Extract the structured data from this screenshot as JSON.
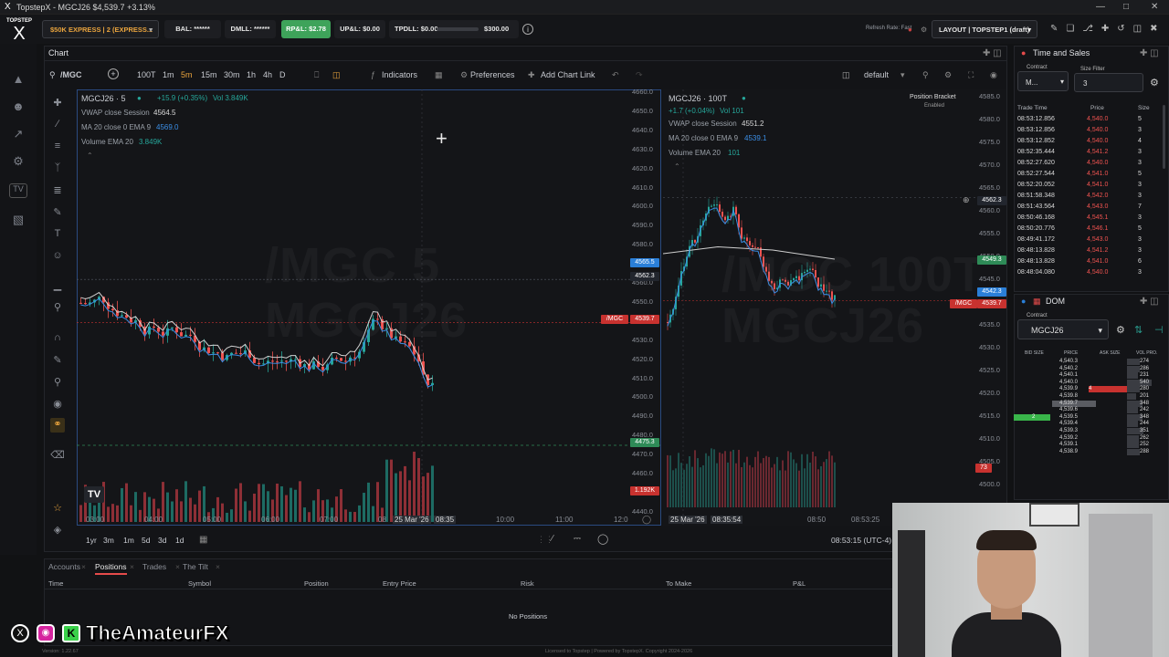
{
  "window": {
    "title": "TopstepX - MGCJ26 $4,539.7 +3.13%"
  },
  "topbar": {
    "account": "$50K EXPRESS | 2 (EXPRESS...",
    "bal": "BAL: ******",
    "dmll": "DMLL: ******",
    "rpl": "RP&L: $2.78",
    "upl": "UP&L: $0.00",
    "tpdll": "TPDLL: $0.00",
    "tpdll_limit": "$300.00",
    "refresh": "Refresh Rate: Fast",
    "layout": "LAYOUT | TOPSTEP1 (draft)"
  },
  "chart_panel": {
    "title": "Chart",
    "symbol": "/MGC",
    "timeframes": [
      "100T",
      "1m",
      "5m",
      "15m",
      "30m",
      "1h",
      "4h",
      "D"
    ],
    "active_timeframe": "5m",
    "indicators_label": "Indicators",
    "preferences_label": "Preferences",
    "add_chart_link_label": "Add Chart Link",
    "layout_name": "default",
    "ranges": [
      "1yr",
      "3m",
      "1m",
      "5d",
      "3d",
      "1d"
    ],
    "clock": "08:53:15 (UTC-4)"
  },
  "left_pane": {
    "title": "MGCJ26 · 5",
    "change": "+15.9 (+0.35%)",
    "vol": "Vol 3.849K",
    "vwap_label": "VWAP close Session",
    "vwap_val": "4564.5",
    "ma_label": "MA 20 close 0 EMA 9",
    "ma_val": "4569.0",
    "vol_label": "Volume EMA 20",
    "vol_val": "3.849K",
    "watermark1": "/MGC 5",
    "watermark2": "MGCJ26",
    "price_ticks": [
      "4660.0",
      "4650.0",
      "4640.0",
      "4630.0",
      "4620.0",
      "4610.0",
      "4600.0",
      "4590.0",
      "4580.0",
      "4570.0",
      "4560.0",
      "4550.0",
      "4540.0",
      "4530.0",
      "4520.0",
      "4510.0",
      "4500.0",
      "4490.0",
      "4480.0",
      "4470.0",
      "4460.0",
      "4450.0",
      "4440.0"
    ],
    "time_ticks": [
      "03:00",
      "04:00",
      "05:00",
      "06:00",
      "07:00",
      "08",
      "25 Mar '26",
      "08:35",
      "10:00",
      "11:00",
      "12:0"
    ],
    "label_vwap": "4565.5",
    "label_ma": "4562.3",
    "label_price": "4539.7",
    "label_symbol": "/MGC",
    "label_dash": "4475.3",
    "label_vol": "1.192K"
  },
  "right_pane": {
    "title": "MGCJ26 · 100T",
    "change": "+1.7 (+0.04%)",
    "vol": "Vol 101",
    "vwap_label": "VWAP close Session",
    "vwap_val": "4551.2",
    "ma_label": "MA 20 close 0 EMA 9",
    "ma_val": "4539.1",
    "vol_label": "Volume EMA 20",
    "vol_val": "101",
    "position_bracket": "Position Bracket",
    "enabled": "Enabled",
    "watermark1": "/MGC 100T",
    "watermark2": "MGCJ26",
    "price_ticks": [
      "4585.0",
      "4580.0",
      "4575.0",
      "4570.0",
      "4565.0",
      "4560.0",
      "4555.0",
      "4550.0",
      "4545.0",
      "4540.0",
      "4535.0",
      "4530.0",
      "4525.0",
      "4520.0",
      "4515.0",
      "4510.0",
      "4505.0",
      "4500.0"
    ],
    "time_ticks": [
      "25 Mar '26",
      "08:35:54",
      "08:50",
      "08:53:25"
    ],
    "label_cross": "4562.3",
    "label_vwap": "4549.3",
    "label_ma": "4542.3",
    "label_price": "4539.7",
    "label_symbol": "/MGC",
    "label_vol": "73"
  },
  "time_sales": {
    "title": "Time and Sales",
    "contract_label": "Contract",
    "contract_value": "M...",
    "size_filter_label": "Size Filter",
    "size_filter_value": "3",
    "headers": [
      "Trade Time",
      "Price",
      "Size"
    ],
    "rows": [
      [
        "08:53:12.856",
        "4,540.0",
        "5"
      ],
      [
        "08:53:12.856",
        "4,540.0",
        "3"
      ],
      [
        "08:53:12.852",
        "4,540.0",
        "4"
      ],
      [
        "08:52:35.444",
        "4,541.2",
        "3"
      ],
      [
        "08:52:27.620",
        "4,540.0",
        "3"
      ],
      [
        "08:52:27.544",
        "4,541.0",
        "5"
      ],
      [
        "08:52:20.052",
        "4,541.0",
        "3"
      ],
      [
        "08:51:58.348",
        "4,542.0",
        "3"
      ],
      [
        "08:51:43.564",
        "4,543.0",
        "7"
      ],
      [
        "08:50:46.168",
        "4,545.1",
        "3"
      ],
      [
        "08:50:20.776",
        "4,546.1",
        "5"
      ],
      [
        "08:49:41.172",
        "4,543.0",
        "3"
      ],
      [
        "08:48:13.828",
        "4,541.2",
        "3"
      ],
      [
        "08:48:13.828",
        "4,541.0",
        "6"
      ],
      [
        "08:48:04.080",
        "4,540.0",
        "3"
      ]
    ]
  },
  "dom": {
    "title": "DOM",
    "contract_label": "Contract",
    "contract": "MGCJ26",
    "headers": [
      "BID SIZE",
      "PRICE",
      "ASK SIZE",
      "VOL PRO."
    ],
    "rows": [
      [
        "",
        "4,540.3",
        "",
        "274"
      ],
      [
        "",
        "4,540.2",
        "",
        "286"
      ],
      [
        "",
        "4,540.1",
        "",
        "231"
      ],
      [
        "",
        "4,540.0",
        "",
        "540"
      ],
      [
        "",
        "4,539.9",
        "4",
        "280"
      ],
      [
        "",
        "4,539.8",
        "",
        "201"
      ],
      [
        "",
        "4,539.7",
        "",
        "348"
      ],
      [
        "",
        "4,539.6",
        "",
        "242"
      ],
      [
        "2",
        "4,539.5",
        "",
        "348"
      ],
      [
        "",
        "4,539.4",
        "",
        "244"
      ],
      [
        "",
        "4,539.3",
        "",
        "351"
      ],
      [
        "",
        "4,539.2",
        "",
        "262"
      ],
      [
        "",
        "4,539.1",
        "",
        "252"
      ],
      [
        "",
        "4,538.9",
        "",
        "288"
      ]
    ]
  },
  "bottom": {
    "tabs": [
      "Accounts",
      "Positions",
      "Trades",
      "The Tilt"
    ],
    "active_tab": "Positions",
    "columns": [
      "Time",
      "Symbol",
      "Position",
      "Entry Price",
      "Risk",
      "To Make",
      "P&L"
    ],
    "empty": "No Positions",
    "version": "Version: 1.22.67",
    "license": "Licensed to Topstep | Powered by TopstepX. Copyright 2024-2026"
  },
  "overlay": {
    "brand": "TheAmateurFX"
  },
  "colors": {
    "up": "#26a69a",
    "down": "#ef5350",
    "accent": "#2a7fd8",
    "green": "#39b54a"
  }
}
